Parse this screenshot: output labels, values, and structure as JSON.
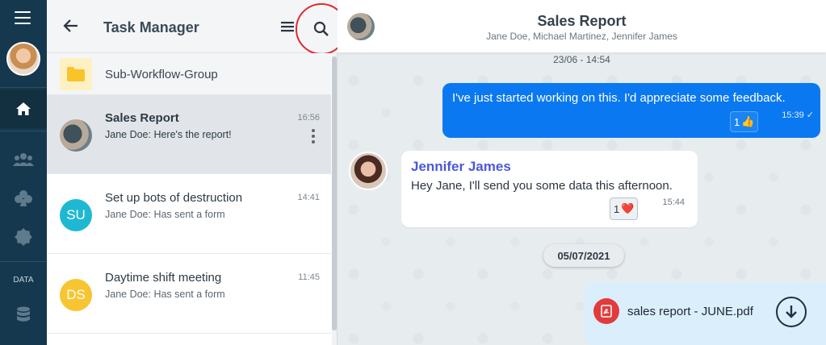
{
  "sidebar": {
    "menu_icon": "hamburger-menu-icon",
    "nav": [
      "home-icon",
      "people-icon",
      "club-icon",
      "gear-badge-icon",
      "database-icon"
    ],
    "data_label": "DATA"
  },
  "list": {
    "title": "Task Manager",
    "group": {
      "label": "Sub-Workflow-Group"
    },
    "chats": [
      {
        "name": "Sales Report",
        "preview": "Jane Doe: Here's the report!",
        "time": "16:56",
        "avatar_text": "",
        "avatar_color": "#5d7079"
      },
      {
        "name": "Set up bots of destruction",
        "preview": "Jane Doe: Has sent a form",
        "time": "14:41",
        "avatar_text": "SU",
        "avatar_color": "#1fb8d3"
      },
      {
        "name": "Daytime shift meeting",
        "preview": "Jane Doe: Has sent a form",
        "time": "11:45",
        "avatar_text": "DS",
        "avatar_color": "#f7c531"
      }
    ]
  },
  "conversation": {
    "title": "Sales Report",
    "participants": "Jane Doe, Michael Martinez, Jennifer James",
    "timestamp_top": "23/06 - 14:54",
    "outgoing": {
      "text": "I've just started working on this. I'd appreciate some feedback.",
      "reaction_count": "1",
      "reaction_emoji": "👍",
      "time": "15:39",
      "status": "✓"
    },
    "incoming": {
      "sender": "Jennifer James",
      "text": "Hey Jane, I'll send you some data this afternoon.",
      "reaction_count": "1",
      "reaction_emoji": "❤️",
      "time": "15:44"
    },
    "date_divider": "05/07/2021",
    "file": {
      "name": "sales report - JUNE.pdf"
    }
  },
  "colors": {
    "rail": "#16384f",
    "accent": "#0a79f1",
    "sender": "#4b58d8",
    "highlight": "#e0282e"
  }
}
